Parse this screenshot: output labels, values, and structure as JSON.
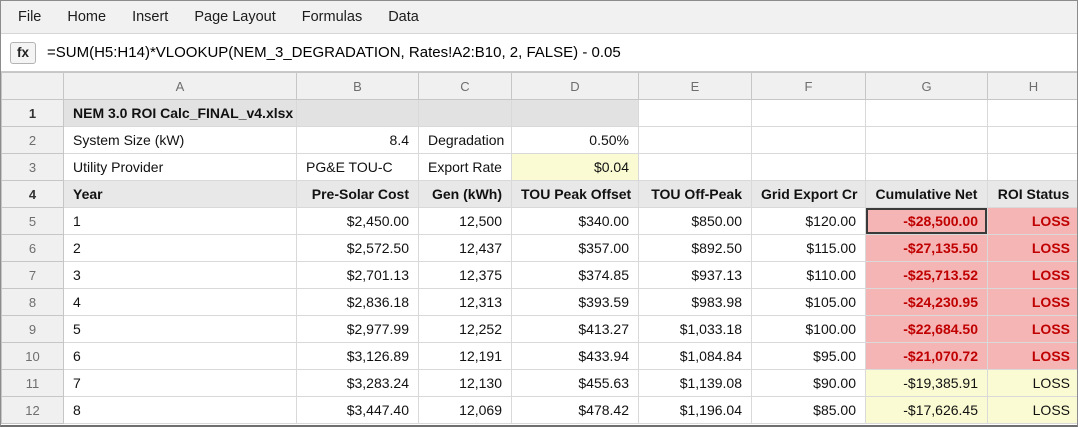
{
  "menu": {
    "items": [
      "File",
      "Home",
      "Insert",
      "Page Layout",
      "Formulas",
      "Data"
    ]
  },
  "formula_bar": {
    "fx_label": "fx",
    "formula": "=SUM(H5:H14)*VLOOKUP(NEM_3_DEGRADATION, Rates!A2:B10, 2, FALSE) - 0.05"
  },
  "grid": {
    "columns": [
      "A",
      "B",
      "C",
      "D",
      "E",
      "F",
      "G",
      "H"
    ],
    "static_row_numbers": [
      "1",
      "2",
      "3",
      "4"
    ]
  },
  "sheet": {
    "title": "NEM 3.0 ROI Calc_FINAL_v4.xlsx",
    "info_rows": [
      {
        "label1": "System Size (kW)",
        "value1": "8.4",
        "label2": "Degradation",
        "value2": "0.50%"
      },
      {
        "label1": "Utility Provider",
        "value1": "PG&E TOU-C",
        "label2": "Export Rate",
        "value2": "$0.04"
      }
    ]
  },
  "table": {
    "headers": [
      "Year",
      "Pre-Solar Cost",
      "Gen (kWh)",
      "TOU Peak Offset",
      "TOU Off-Peak",
      "Grid Export Cr",
      "Cumulative Net",
      "ROI Status"
    ],
    "rows": [
      {
        "n": "5",
        "year": "1",
        "pre": "$2,450.00",
        "gen": "12,500",
        "peak": "$340.00",
        "off": "$850.00",
        "export": "$120.00",
        "net": "-$28,500.00",
        "status": "LOSS",
        "tone": "red",
        "selected": true
      },
      {
        "n": "6",
        "year": "2",
        "pre": "$2,572.50",
        "gen": "12,437",
        "peak": "$357.00",
        "off": "$892.50",
        "export": "$115.00",
        "net": "-$27,135.50",
        "status": "LOSS",
        "tone": "red"
      },
      {
        "n": "7",
        "year": "3",
        "pre": "$2,701.13",
        "gen": "12,375",
        "peak": "$374.85",
        "off": "$937.13",
        "export": "$110.00",
        "net": "-$25,713.52",
        "status": "LOSS",
        "tone": "red"
      },
      {
        "n": "8",
        "year": "4",
        "pre": "$2,836.18",
        "gen": "12,313",
        "peak": "$393.59",
        "off": "$983.98",
        "export": "$105.00",
        "net": "-$24,230.95",
        "status": "LOSS",
        "tone": "red"
      },
      {
        "n": "9",
        "year": "5",
        "pre": "$2,977.99",
        "gen": "12,252",
        "peak": "$413.27",
        "off": "$1,033.18",
        "export": "$100.00",
        "net": "-$22,684.50",
        "status": "LOSS",
        "tone": "red"
      },
      {
        "n": "10",
        "year": "6",
        "pre": "$3,126.89",
        "gen": "12,191",
        "peak": "$433.94",
        "off": "$1,084.84",
        "export": "$95.00",
        "net": "-$21,070.72",
        "status": "LOSS",
        "tone": "red"
      },
      {
        "n": "11",
        "year": "7",
        "pre": "$3,283.24",
        "gen": "12,130",
        "peak": "$455.63",
        "off": "$1,139.08",
        "export": "$90.00",
        "net": "-$19,385.91",
        "status": "LOSS",
        "tone": "yellow"
      },
      {
        "n": "12",
        "year": "8",
        "pre": "$3,447.40",
        "gen": "12,069",
        "peak": "$478.42",
        "off": "$1,196.04",
        "export": "$85.00",
        "net": "-$17,626.45",
        "status": "LOSS",
        "tone": "yellow"
      }
    ]
  },
  "colors": {
    "loss_bg": "#f5b5b5",
    "loss_text": "#c00000",
    "warn_bg": "#fbfbd3",
    "table_header_bg": "#e8e8e8",
    "title_row_bg": "#e2e2e2"
  }
}
